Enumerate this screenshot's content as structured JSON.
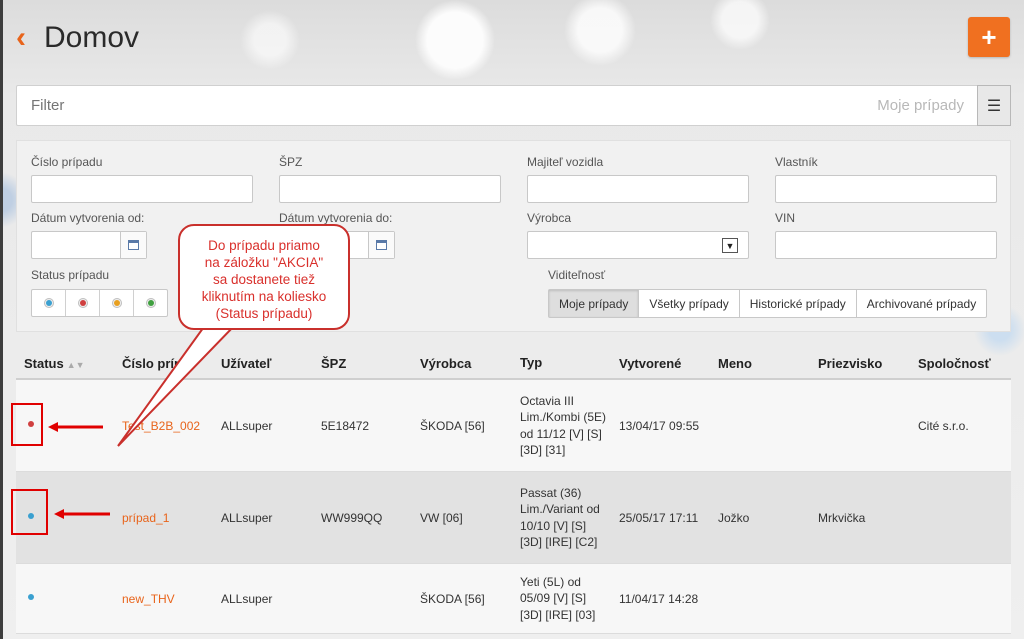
{
  "header": {
    "title": "Domov"
  },
  "filter": {
    "placeholder": "Filter",
    "scope": "Moje prípady"
  },
  "panel": {
    "case_number_label": "Číslo prípadu",
    "spz_label": "ŠPZ",
    "owner_vehicle_label": "Majiteľ vozidla",
    "owner_label": "Vlastník",
    "created_from_label": "Dátum vytvorenia od:",
    "created_to_label": "Dátum vytvorenia do:",
    "maker_label": "Výrobca",
    "vin_label": "VIN",
    "status_label": "Status prípadu",
    "visibility_label": "Viditeľnosť",
    "visibility_options": [
      "Moje prípady",
      "Všetky prípady",
      "Historické prípady",
      "Archivované prípady"
    ],
    "visibility_selected": "Moje prípady"
  },
  "table": {
    "columns": [
      "Status",
      "Číslo prípa",
      "Užívateľ",
      "ŠPZ",
      "Výrobca",
      "Typ",
      "Vytvorené",
      "Meno",
      "Priezvisko",
      "Spoločnosť"
    ],
    "rows": [
      {
        "case": "Test_B2B_002",
        "user": "ALLsuper",
        "spz": "5E18472",
        "make": "ŠKODA [56]",
        "type": "Octavia III Lim./Kombi (5E) od 11/12 [V] [S] [3D] [31]",
        "created": "13/04/17 09:55",
        "name": "",
        "surname": "",
        "company": "Cité s.r.o."
      },
      {
        "case": "prípad_1",
        "user": "ALLsuper",
        "spz": "WW999QQ",
        "make": "VW [06]",
        "type": "Passat (36) Lim./Variant od 10/10 [V] [S] [3D] [IRE] [C2]",
        "created": "25/05/17 17:11",
        "name": "Jožko",
        "surname": "Mrkvička",
        "company": ""
      },
      {
        "case": "new_THV",
        "user": "ALLsuper",
        "spz": "",
        "make": "ŠKODA [56]",
        "type": "Yeti (5L) od 05/09 [V] [S] [3D] [IRE] [03]",
        "created": "11/04/17 14:28",
        "name": "",
        "surname": "",
        "company": ""
      }
    ]
  },
  "annotation": {
    "callout_lines": [
      "Do prípadu priamo",
      "na záložku \"AKCIA\"",
      "sa dostanete tiež",
      "kliknutím na koliesko",
      "(Status prípadu)"
    ]
  },
  "icons": [
    "back-chevron-icon",
    "plus-icon",
    "hamburger-icon",
    "calendar-icon",
    "chevron-down-icon",
    "sort-icon",
    "status-dot-icon"
  ],
  "colors": {
    "accent": "#f07020",
    "link": "#e8641b",
    "annotation": "#e00000"
  }
}
